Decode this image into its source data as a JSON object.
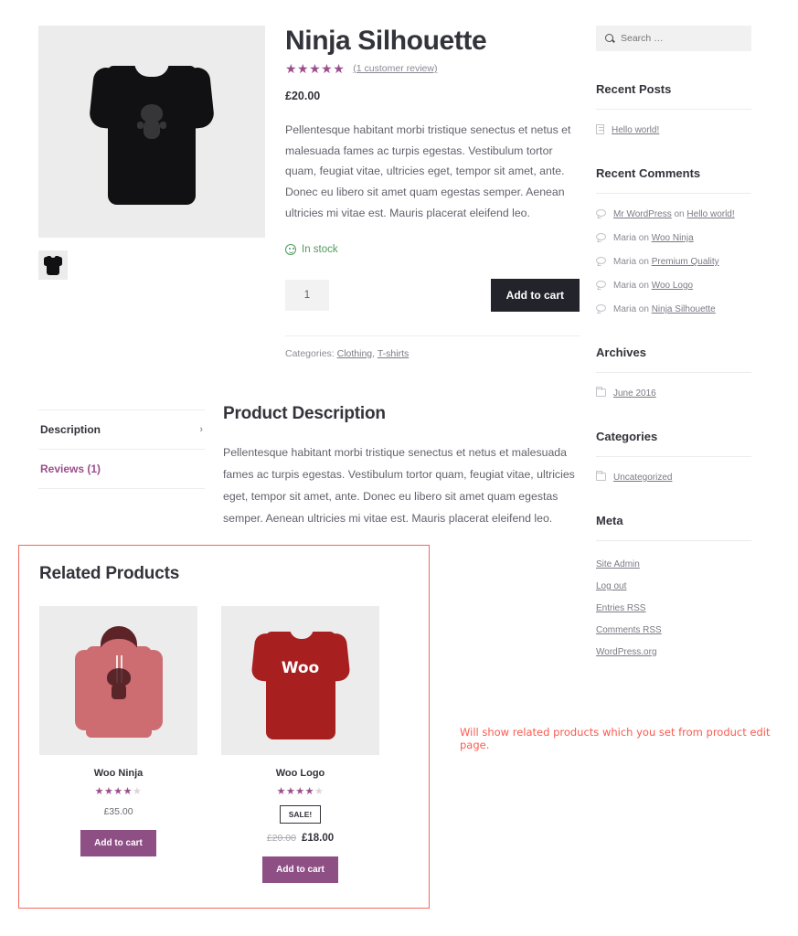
{
  "product": {
    "title": "Ninja Silhouette",
    "stars_filled": 5,
    "stars_total": 5,
    "review_link": "(1 customer review)",
    "price": "£20.00",
    "short_description": "Pellentesque habitant morbi tristique senectus et netus et malesuada fames ac turpis egestas. Vestibulum tortor quam, feugiat vitae, ultricies eget, tempor sit amet, ante. Donec eu libero sit amet quam egestas semper. Aenean ultricies mi vitae est. Mauris placerat eleifend leo.",
    "stock_status": "In stock",
    "quantity": "1",
    "add_to_cart_label": "Add to cart",
    "categories_label": "Categories:",
    "categories": "Clothing, T-shirts",
    "category_items": [
      "Clothing",
      "T-shirts"
    ],
    "gallery_alt": "Black t-shirt with ninja silhouette graphic",
    "thumb_alt": "Black t-shirt thumbnail"
  },
  "tabs": [
    {
      "label": "Description",
      "active": true,
      "chevron": "›"
    },
    {
      "label": "Reviews (1)",
      "active": false,
      "chevron": ""
    }
  ],
  "description_panel": {
    "title": "Product Description",
    "body": "Pellentesque habitant morbi tristique senectus et netus et malesuada fames ac turpis egestas. Vestibulum tortor quam, feugiat vitae, ultricies eget, tempor sit amet, ante. Donec eu libero sit amet quam egestas semper. Aenean ultricies mi vitae est. Mauris placerat eleifend leo."
  },
  "related": {
    "title": "Related Products",
    "annotation": "Will show related products which you set from product edit page.",
    "annotation_color": "#fa5a50",
    "border_color": "#f4685e",
    "products": [
      {
        "name": "Woo Ninja",
        "stars_filled": 4,
        "half_star": true,
        "stars_total": 5,
        "price": "£35.00",
        "on_sale": false,
        "sale_label": "",
        "old_price": "",
        "new_price": "",
        "add_to_cart_label": "Add to cart",
        "image_alt": "Pink hoodie with ninja logo"
      },
      {
        "name": "Woo Logo",
        "stars_filled": 4,
        "half_star": false,
        "stars_total": 5,
        "price": "",
        "on_sale": true,
        "sale_label": "SALE!",
        "old_price": "£20.00",
        "new_price": "£18.00",
        "add_to_cart_label": "Add to cart",
        "image_alt": "Red t-shirt with Woo logo",
        "image_text": "Woo"
      }
    ]
  },
  "sidebar": {
    "search": {
      "placeholder": "Search …",
      "value": ""
    },
    "widgets": [
      {
        "title": "Recent Posts",
        "type": "posts",
        "items": [
          {
            "prefix": "",
            "link": "Hello world!",
            "suffix": "",
            "link2": ""
          }
        ]
      },
      {
        "title": "Recent Comments",
        "type": "comments",
        "items": [
          {
            "prefix": "",
            "link": "Mr WordPress",
            "suffix": " on ",
            "link2": "Hello world!"
          },
          {
            "prefix": "Maria",
            "link": "",
            "suffix": " on ",
            "link2": "Woo Ninja"
          },
          {
            "prefix": "Maria",
            "link": "",
            "suffix": " on ",
            "link2": "Premium Quality"
          },
          {
            "prefix": "Maria",
            "link": "",
            "suffix": " on ",
            "link2": "Woo Logo"
          },
          {
            "prefix": "Maria",
            "link": "",
            "suffix": " on ",
            "link2": "Ninja Silhouette"
          }
        ]
      },
      {
        "title": "Archives",
        "type": "folder",
        "items": [
          {
            "prefix": "",
            "link": "June 2016",
            "suffix": "",
            "link2": ""
          }
        ]
      },
      {
        "title": "Categories",
        "type": "folder",
        "items": [
          {
            "prefix": "",
            "link": "Uncategorized",
            "suffix": "",
            "link2": ""
          }
        ]
      }
    ],
    "meta": {
      "title": "Meta",
      "links": [
        "Site Admin",
        "Log out",
        "Entries RSS",
        "Comments RSS",
        "WordPress.org"
      ]
    }
  },
  "colors": {
    "accent_purple": "#9b4e8c",
    "button_purple": "#8e4f85",
    "dark_button": "#23232b",
    "in_stock_green": "#4f9a5c",
    "annotation_red": "#fa5a50"
  }
}
